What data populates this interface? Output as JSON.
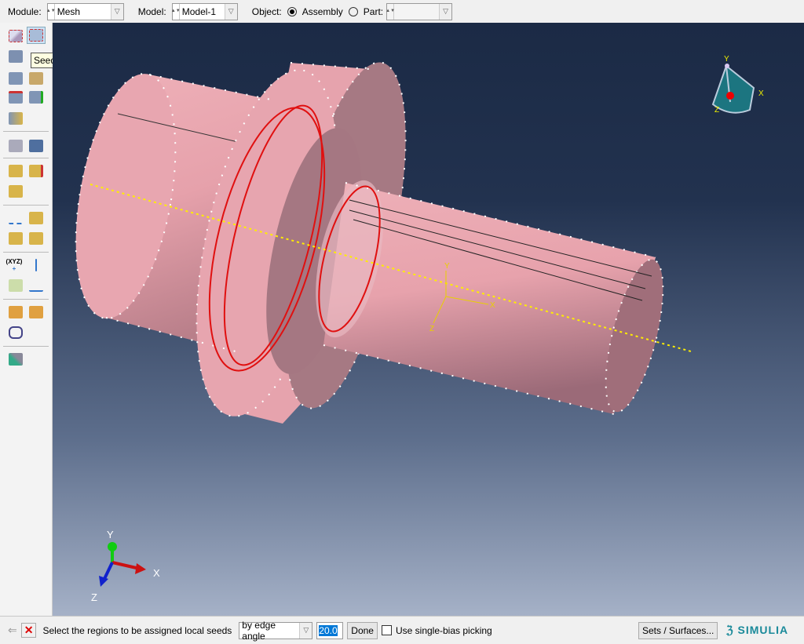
{
  "topbar": {
    "module_label": "Module:",
    "module_value": "Mesh",
    "model_label": "Model:",
    "model_value": "Model-1",
    "object_label": "Object:",
    "assembly_label": "Assembly",
    "part_label": "Part:",
    "part_value": "",
    "object_selected": "Assembly"
  },
  "toolbox": {
    "tooltip": "Seed Edges",
    "xyz_label": "(XYZ)"
  },
  "viewport": {
    "triad": {
      "x": "X",
      "y": "Y",
      "z": "Z"
    },
    "csys": {
      "x": "X",
      "y": "Y",
      "z": "Z"
    },
    "view_cube": {
      "x": "X",
      "y": "Y",
      "z": "Z"
    },
    "part_color": "#e8a4ad",
    "highlight_color": "#e01010",
    "axis_color": "#ffee00"
  },
  "prompt": {
    "message": "Select the regions to be assigned local seeds",
    "method": "by edge angle",
    "angle_value": "20.0",
    "done_label": "Done",
    "single_bias_label": "Use single-bias picking",
    "single_bias_checked": false,
    "sets_label": "Sets / Surfaces...",
    "brand": "SIMULIA"
  }
}
